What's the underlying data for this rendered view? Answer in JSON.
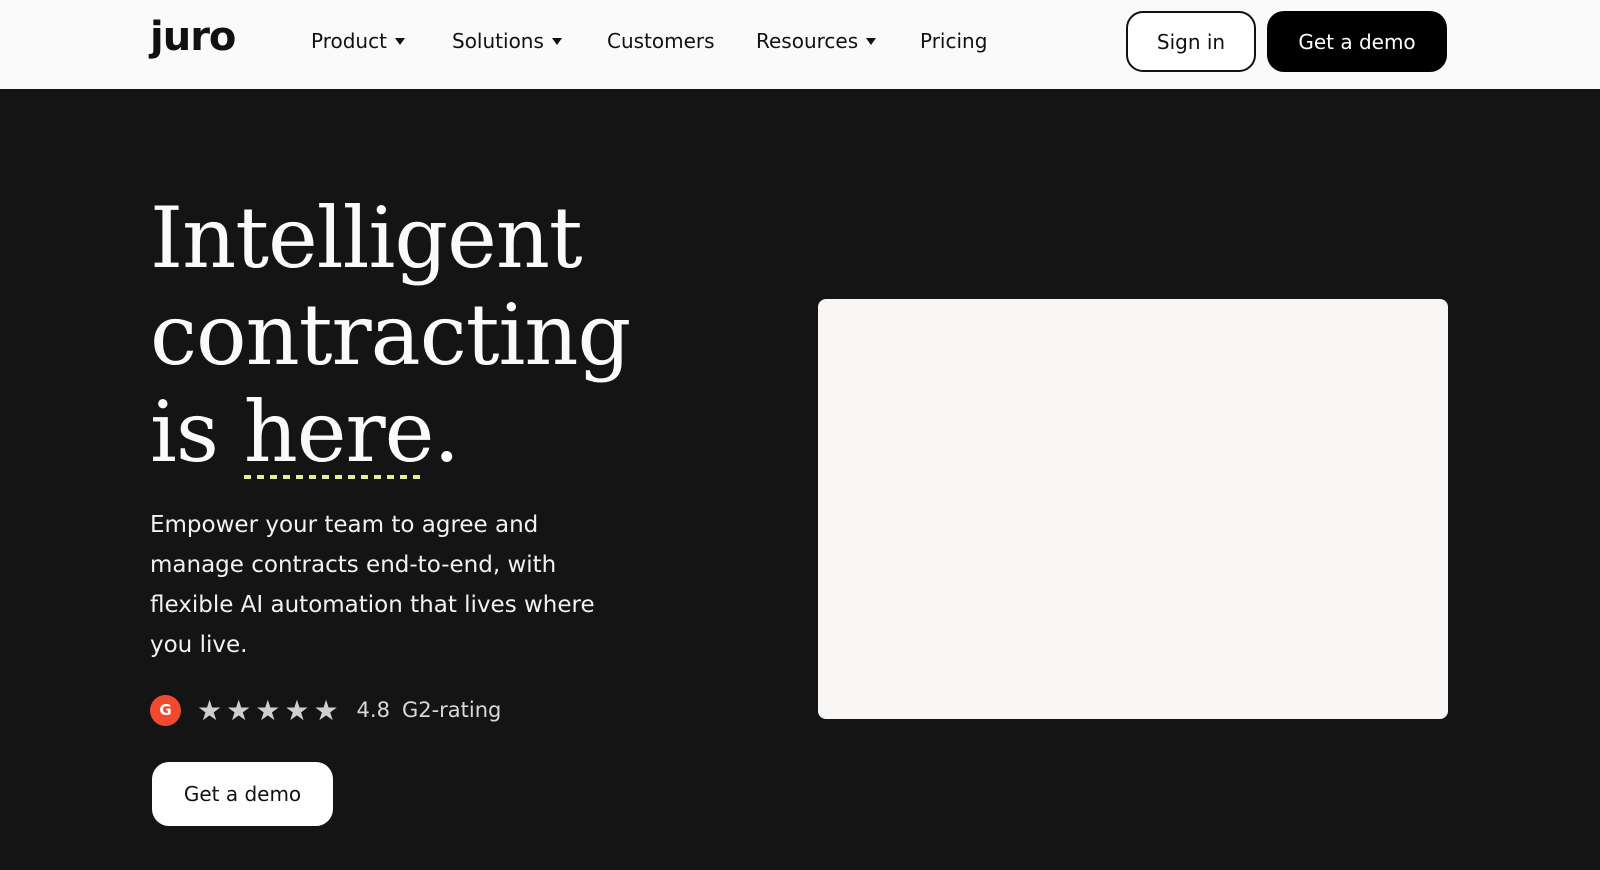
{
  "brand": {
    "logo_text": "juro"
  },
  "nav": {
    "items": [
      {
        "label": "Product",
        "has_dropdown": true
      },
      {
        "label": "Solutions",
        "has_dropdown": true
      },
      {
        "label": "Customers",
        "has_dropdown": false
      },
      {
        "label": "Resources",
        "has_dropdown": true
      },
      {
        "label": "Pricing",
        "has_dropdown": false
      }
    ],
    "sign_in_label": "Sign in",
    "demo_label": "Get a demo"
  },
  "hero": {
    "title_line1": "Intelligent",
    "title_line2": "contracting",
    "title_line3_prefix": "is ",
    "title_line3_highlight": "here",
    "title_line3_suffix": ".",
    "subtitle": "Empower your team to agree and manage contracts end-to-end, with flexible AI automation that lives where you live.",
    "rating": {
      "badge_text": "G",
      "stars": 5,
      "value": "4.8",
      "label": "G2-rating"
    },
    "cta_label": "Get a demo"
  },
  "colors": {
    "hero_bg": "#141414",
    "nav_bg": "#fafafa",
    "accent_underline": "#e6ee9c",
    "g2_red": "#ef4a2e",
    "panel_bg": "#f8f7f5"
  }
}
